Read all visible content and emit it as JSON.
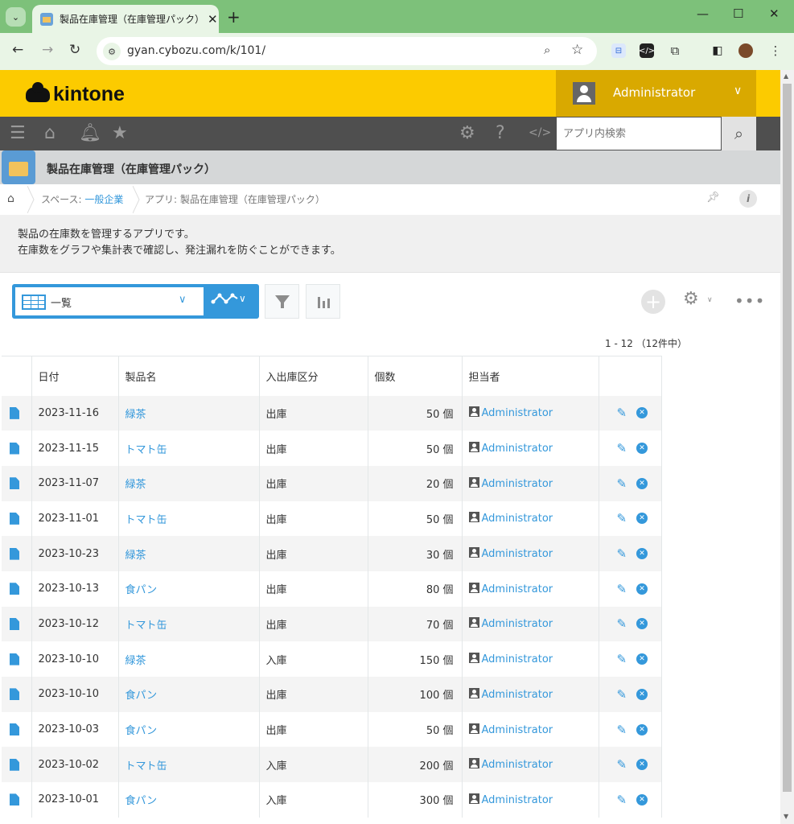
{
  "browser": {
    "tab_title": "製品在庫管理（在庫管理パック）",
    "url": "gyan.cybozu.com/k/101/"
  },
  "header": {
    "logo": "kintone",
    "user_name": "Administrator"
  },
  "search": {
    "placeholder": "アプリ内検索"
  },
  "app": {
    "title": "製品在庫管理（在庫管理パック）",
    "description_line1": "製品の在庫数を管理するアプリです。",
    "description_line2": "在庫数をグラフや集計表で確認し、発注漏れを防ぐことができます。"
  },
  "breadcrumb": {
    "space_prefix": "スペース: ",
    "space_name": "一般企業",
    "app_label": "アプリ: 製品在庫管理（在庫管理パック）"
  },
  "view": {
    "name": "一覧",
    "count": "1 - 12 （12件中）"
  },
  "table": {
    "headers": [
      "日付",
      "製品名",
      "入出庫区分",
      "個数",
      "担当者"
    ],
    "rows": [
      {
        "date": "2023-11-16",
        "product": "緑茶",
        "type": "出庫",
        "qty": "50 個",
        "user": "Administrator"
      },
      {
        "date": "2023-11-15",
        "product": "トマト缶",
        "type": "出庫",
        "qty": "50 個",
        "user": "Administrator"
      },
      {
        "date": "2023-11-07",
        "product": "緑茶",
        "type": "出庫",
        "qty": "20 個",
        "user": "Administrator"
      },
      {
        "date": "2023-11-01",
        "product": "トマト缶",
        "type": "出庫",
        "qty": "50 個",
        "user": "Administrator"
      },
      {
        "date": "2023-10-23",
        "product": "緑茶",
        "type": "出庫",
        "qty": "30 個",
        "user": "Administrator"
      },
      {
        "date": "2023-10-13",
        "product": "食パン",
        "type": "出庫",
        "qty": "80 個",
        "user": "Administrator"
      },
      {
        "date": "2023-10-12",
        "product": "トマト缶",
        "type": "出庫",
        "qty": "70 個",
        "user": "Administrator"
      },
      {
        "date": "2023-10-10",
        "product": "緑茶",
        "type": "入庫",
        "qty": "150 個",
        "user": "Administrator"
      },
      {
        "date": "2023-10-10",
        "product": "食パン",
        "type": "出庫",
        "qty": "100 個",
        "user": "Administrator"
      },
      {
        "date": "2023-10-03",
        "product": "食パン",
        "type": "出庫",
        "qty": "50 個",
        "user": "Administrator"
      },
      {
        "date": "2023-10-02",
        "product": "トマト缶",
        "type": "入庫",
        "qty": "200 個",
        "user": "Administrator"
      },
      {
        "date": "2023-10-01",
        "product": "食パン",
        "type": "入庫",
        "qty": "300 個",
        "user": "Administrator"
      }
    ]
  },
  "colors": {
    "brand_yellow": "#fccb00",
    "accent_blue": "#3498db",
    "browser_green": "#7dc17a"
  }
}
